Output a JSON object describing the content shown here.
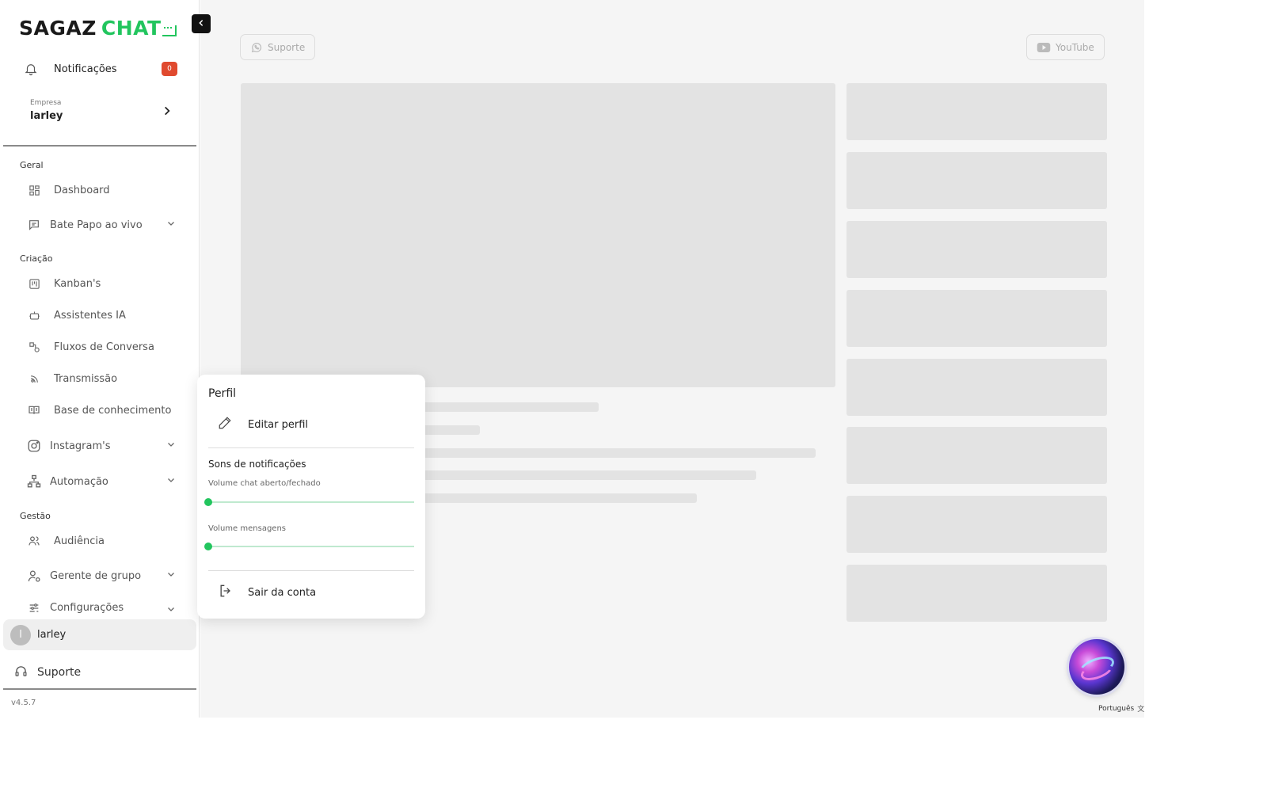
{
  "brand": {
    "logo_primary": "SAGAZ",
    "logo_accent": "CHAT",
    "accent_color": "#22c55e"
  },
  "sidebar": {
    "notifications": {
      "label": "Notificações",
      "count": "0",
      "icon": "bell-icon"
    },
    "company": {
      "caption": "Empresa",
      "name": "larley"
    },
    "sections": {
      "geral": "Geral",
      "criacao": "Criação",
      "gestao": "Gestão"
    },
    "items": [
      {
        "label": "Dashboard",
        "icon": "grid-icon"
      },
      {
        "label": "Bate Papo ao vivo",
        "icon": "chat-icon"
      },
      {
        "label": "Kanban's",
        "icon": "kanban-icon"
      },
      {
        "label": "Assistentes IA",
        "icon": "bot-icon"
      },
      {
        "label": "Fluxos de Conversa",
        "icon": "flow-icon"
      },
      {
        "label": "Transmissão",
        "icon": "broadcast-icon"
      },
      {
        "label": "Base de conhecimento",
        "icon": "book-icon"
      },
      {
        "label": "Instagram's",
        "icon": "instagram-icon"
      },
      {
        "label": "Automação",
        "icon": "automation-icon"
      },
      {
        "label": "Audiência",
        "icon": "users-icon"
      },
      {
        "label": "Gerente de grupo",
        "icon": "group-manager-icon"
      },
      {
        "label": "Configurações",
        "icon": "settings-icon"
      }
    ],
    "user": {
      "initial": "l",
      "name": "larley"
    },
    "support": "Suporte",
    "version": "v4.5.7"
  },
  "topbar": {
    "support_button": "Suporte",
    "youtube_button": "YouTube"
  },
  "language": "Português",
  "profile_menu": {
    "title": "Perfil",
    "edit_profile": "Editar perfil",
    "sounds_title": "Sons de notificações",
    "volume_chat_label": "Volume chat aberto/fechado",
    "volume_chat_value": 0,
    "volume_messages_label": "Volume mensagens",
    "volume_messages_value": 0,
    "logout": "Sair da conta"
  }
}
